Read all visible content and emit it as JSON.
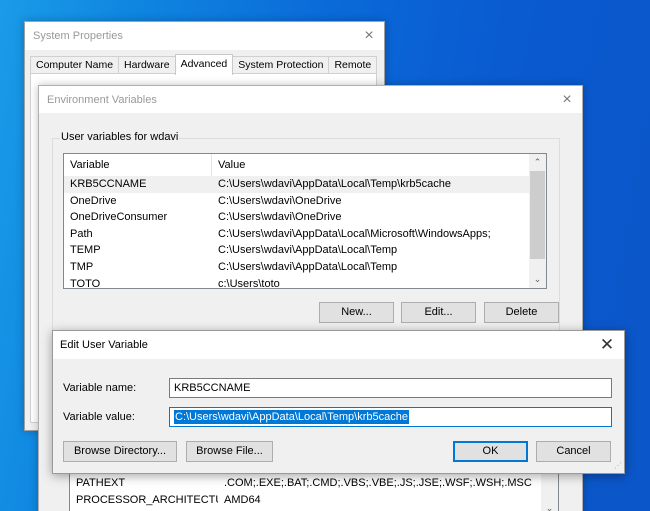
{
  "system_properties": {
    "title": "System Properties",
    "close_icon": "×",
    "tabs": [
      {
        "label": "Computer Name",
        "active": false
      },
      {
        "label": "Hardware",
        "active": false
      },
      {
        "label": "Advanced",
        "active": true
      },
      {
        "label": "System Protection",
        "active": false
      },
      {
        "label": "Remote",
        "active": false
      }
    ]
  },
  "environment_variables": {
    "title": "Environment Variables",
    "close_icon": "×",
    "user_group_label": "User variables for wdavi",
    "columns": {
      "variable": "Variable",
      "value": "Value"
    },
    "user_variables": [
      {
        "variable": "KRB5CCNAME",
        "value": "C:\\Users\\wdavi\\AppData\\Local\\Temp\\krb5cache",
        "selected": true
      },
      {
        "variable": "OneDrive",
        "value": "C:\\Users\\wdavi\\OneDrive",
        "selected": false
      },
      {
        "variable": "OneDriveConsumer",
        "value": "C:\\Users\\wdavi\\OneDrive",
        "selected": false
      },
      {
        "variable": "Path",
        "value": "C:\\Users\\wdavi\\AppData\\Local\\Microsoft\\WindowsApps;",
        "selected": false
      },
      {
        "variable": "TEMP",
        "value": "C:\\Users\\wdavi\\AppData\\Local\\Temp",
        "selected": false
      },
      {
        "variable": "TMP",
        "value": "C:\\Users\\wdavi\\AppData\\Local\\Temp",
        "selected": false
      },
      {
        "variable": "TOTO",
        "value": "c:\\Users\\toto",
        "selected": false
      }
    ],
    "buttons": {
      "new": "New...",
      "edit": "Edit...",
      "delete": "Delete"
    },
    "system_variables_visible": [
      {
        "variable": "PATHEXT",
        "value": ".COM;.EXE;.BAT;.CMD;.VBS;.VBE;.JS;.JSE;.WSF;.WSH;.MSC"
      },
      {
        "variable": "PROCESSOR_ARCHITECTURE",
        "value": "AMD64"
      }
    ],
    "scroll_up_icon": "⌃",
    "scroll_down_icon": "⌄"
  },
  "edit_user_variable": {
    "title": "Edit User Variable",
    "close_icon": "✕",
    "name_label": "Variable name:",
    "name_value": "KRB5CCNAME",
    "value_label": "Variable value:",
    "value_value": "C:\\Users\\wdavi\\AppData\\Local\\Temp\\krb5cache",
    "buttons": {
      "browse_directory": "Browse Directory...",
      "browse_file": "Browse File...",
      "ok": "OK",
      "cancel": "Cancel"
    },
    "resize_grip_icon": "⋰"
  },
  "colors": {
    "accent": "#0078d7",
    "desktop": "#0a6ad8",
    "dialog_bg": "#f0f0f0"
  }
}
